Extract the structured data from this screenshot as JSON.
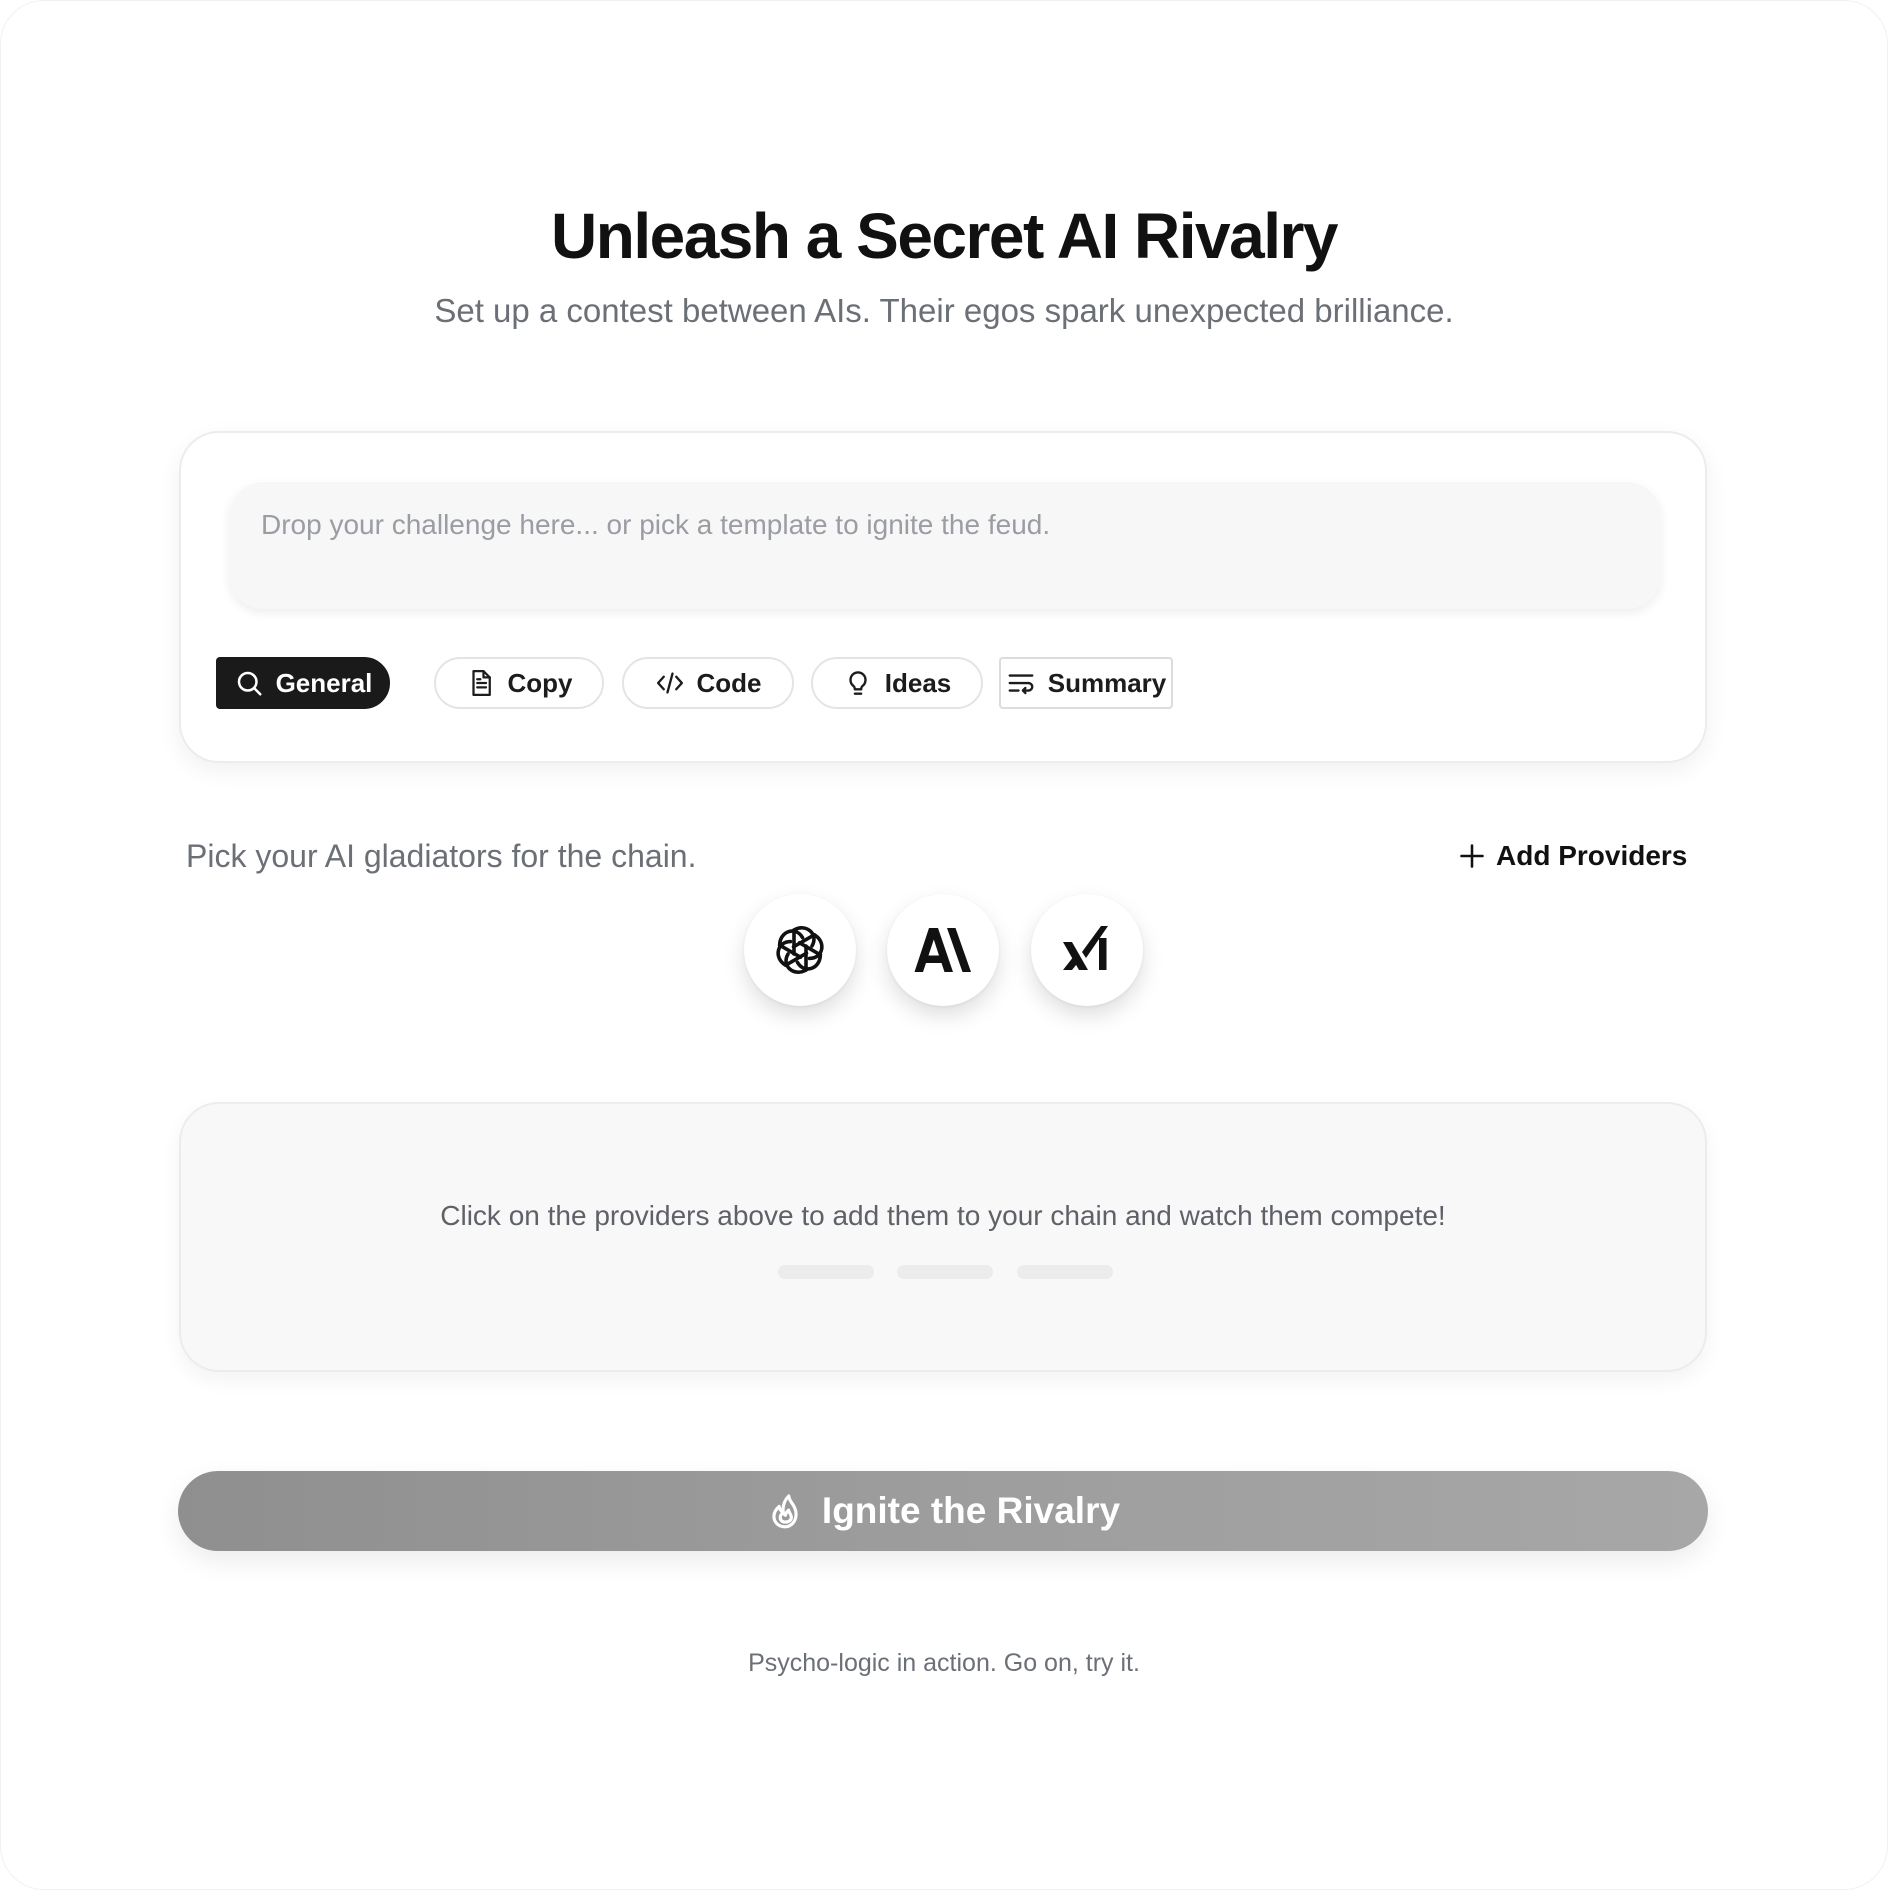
{
  "header": {
    "title": "Unleash a Secret AI Rivalry",
    "subtitle": "Set up a contest between AIs. Their egos spark unexpected brilliance."
  },
  "prompt": {
    "value": "",
    "placeholder": "Drop your challenge here... or pick a template to ignite the feud."
  },
  "templates": [
    {
      "label": "General",
      "icon": "search-icon",
      "selected": true
    },
    {
      "label": "Copy",
      "icon": "document-icon",
      "selected": false
    },
    {
      "label": "Code",
      "icon": "code-icon",
      "selected": false
    },
    {
      "label": "Ideas",
      "icon": "lightbulb-icon",
      "selected": false
    },
    {
      "label": "Summary",
      "icon": "summary-lines-icon",
      "selected": false
    }
  ],
  "providers": {
    "label": "Pick your AI gladiators for the chain.",
    "add_label": "Add Providers",
    "items": [
      {
        "name": "OpenAI",
        "icon": "openai-logo-icon"
      },
      {
        "name": "Anthropic",
        "icon": "anthropic-logo-icon"
      },
      {
        "name": "xAI",
        "icon": "xai-logo-icon"
      }
    ]
  },
  "chain": {
    "empty_hint": "Click on the providers above to add them to your chain and watch them compete!"
  },
  "action": {
    "ignite_label": "Ignite the Rivalry",
    "icon": "flame-icon"
  },
  "footer": {
    "note": "Psycho-logic in action. Go on, try it."
  },
  "colors": {
    "active_chip": "#1a1a1a",
    "muted_text": "#6b6f76",
    "ignite_button": "#9d9d9d"
  }
}
